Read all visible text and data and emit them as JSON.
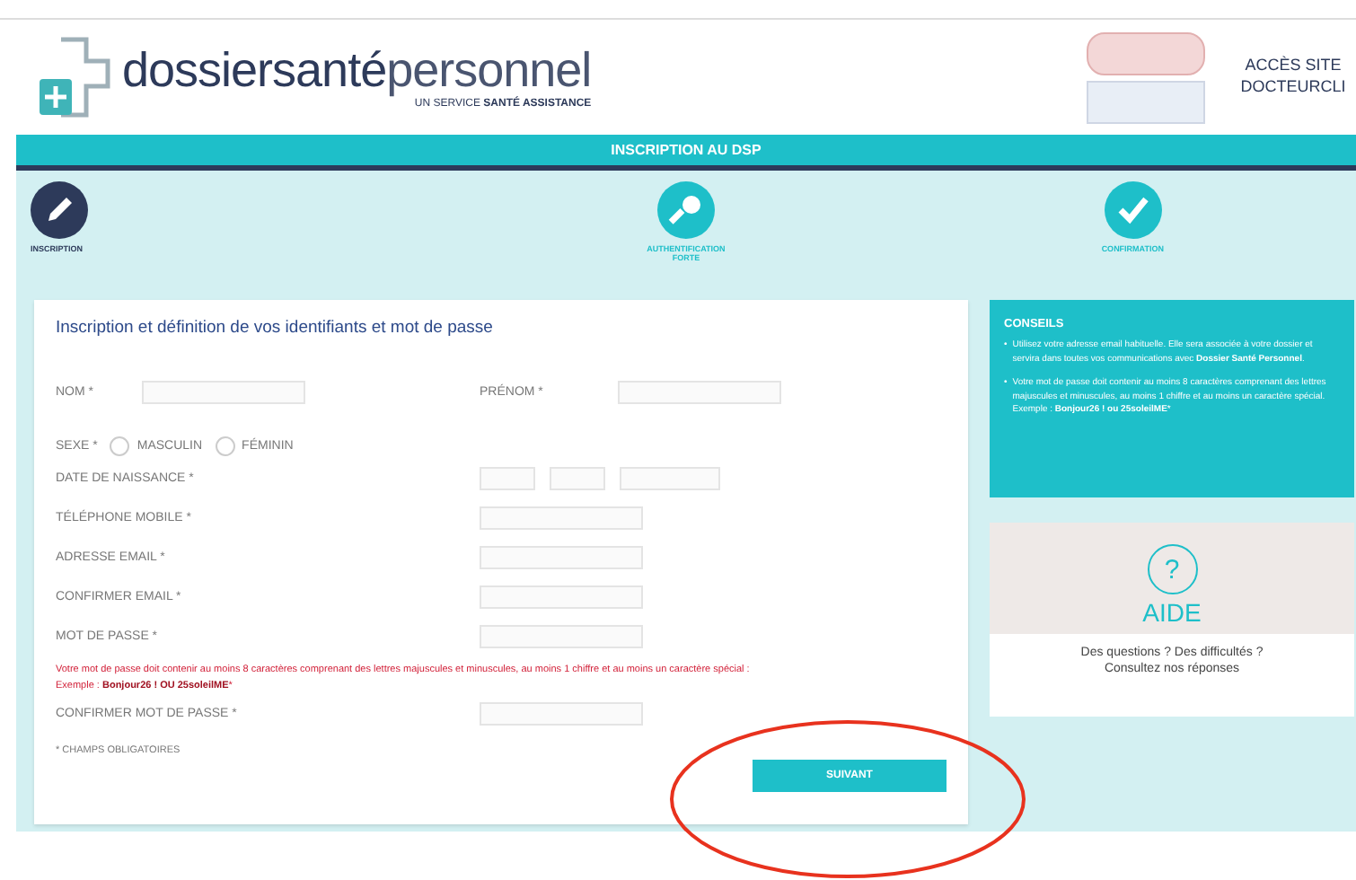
{
  "header": {
    "logo_name": "dossiersanté",
    "logo_name_light": "personnel",
    "tagline_prefix": "UN SERVICE",
    "tagline_brand": "SANTÉ ASSISTANCE",
    "access_link": [
      "ACCÈS SITE",
      "DOCTEURCLI"
    ]
  },
  "banner": {
    "title": "INSCRIPTION AU DSP"
  },
  "steps": [
    {
      "label": "INSCRIPTION",
      "kind": "pencil",
      "selected": true
    },
    {
      "label": "AUTHENTIFICATION FORTE",
      "kind": "key",
      "selected": false
    },
    {
      "label": "CONFIRMATION",
      "kind": "check",
      "selected": false
    }
  ],
  "form": {
    "title": "Inscription et définition de vos identifiants et mot de passe",
    "name_fields": [
      {
        "label": "NOM *"
      },
      {
        "label": "PRÉNOM *"
      }
    ],
    "sex": {
      "label": "SEXE *",
      "options": [
        {
          "label": "MASCULIN",
          "selected": false
        },
        {
          "label": "FÉMININ",
          "selected": false
        }
      ]
    },
    "birth_date": {
      "label": "DATE DE NAISSANCE *"
    },
    "fields": [
      {
        "label": "TÉLÉPHONE MOBILE *"
      },
      {
        "label": "ADRESSE EMAIL *"
      },
      {
        "label": "CONFIRMER EMAIL *"
      },
      {
        "label": "MOT DE PASSE *"
      }
    ],
    "password_hint": "Votre mot de passe doit contenir au moins 8 caractères comprenant des lettres majuscules et minuscules, au moins 1 chiffre et au moins un caractère spécial :",
    "password_example": "Exemple : **Bonjour26 ! OU 25soleilME***",
    "confirm_password": {
      "label": "CONFIRMER MOT DE PASSE *"
    },
    "required_note": "* CHAMPS OBLIGATOIRES",
    "submit": "SUIVANT"
  },
  "tips": {
    "title": "CONSEILS",
    "items": [
      {
        "bullet": "•",
        "text": "Utilisez votre adresse email habituelle. Elle sera associée à votre dossier et servira dans toutes vos communications avec **Dossier Santé Personnel**."
      },
      {
        "bullet": "•",
        "text": "Votre mot de passe doit contenir au moins 8 caractères comprenant des lettres majuscules et minuscules, au moins 1 chiffre et au moins un caractère spécial. Exemple : **Bonjour26 ! ou 25soleilME***"
      }
    ]
  },
  "help": {
    "icon": "?",
    "title": "AIDE",
    "text": [
      "Des questions ? Des difficultés ?",
      "Consultez nos réponses"
    ]
  }
}
